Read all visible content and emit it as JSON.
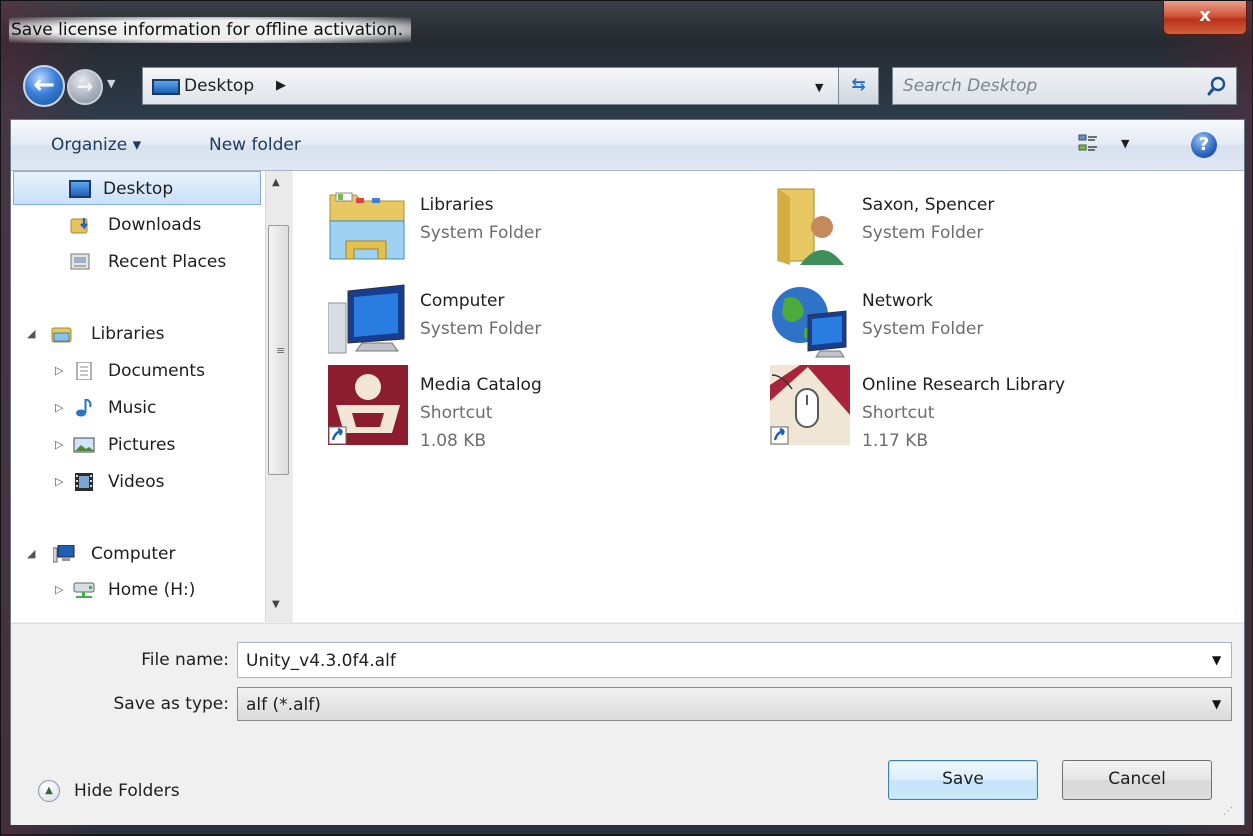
{
  "window": {
    "title": "Save license information for offline activation.",
    "close_label": "x"
  },
  "nav": {
    "back_glyph": "←",
    "forward_glyph": "→",
    "address_location": "Desktop",
    "search_placeholder": "Search Desktop"
  },
  "toolbar": {
    "organize_label": "Organize ▾",
    "new_folder_label": "New folder",
    "help_glyph": "?"
  },
  "sidebar": {
    "items": [
      {
        "label": "Desktop",
        "selected": true
      },
      {
        "label": "Downloads"
      },
      {
        "label": "Recent Places"
      },
      {
        "label": "Libraries"
      },
      {
        "label": "Documents"
      },
      {
        "label": "Music"
      },
      {
        "label": "Pictures"
      },
      {
        "label": "Videos"
      },
      {
        "label": "Computer"
      },
      {
        "label": "Home (H:)"
      }
    ]
  },
  "files": [
    {
      "name": "Libraries",
      "type": "System Folder",
      "icon": "libraries-folder-icon"
    },
    {
      "name": "Saxon, Spencer",
      "type": "System Folder",
      "icon": "user-folder-icon"
    },
    {
      "name": "Computer",
      "type": "System Folder",
      "icon": "computer-icon"
    },
    {
      "name": "Network",
      "type": "System Folder",
      "icon": "network-icon"
    },
    {
      "name": "Media Catalog",
      "type": "Shortcut",
      "size": "1.08 KB",
      "icon": "media-catalog-shortcut-icon"
    },
    {
      "name": "Online Research Library",
      "type": "Shortcut",
      "size": "1.17 KB",
      "icon": "research-library-shortcut-icon"
    }
  ],
  "form": {
    "file_name_label": "File name:",
    "file_name_value": "Unity_v4.3.0f4.alf",
    "save_type_label": "Save as type:",
    "save_type_value": "alf (*.alf)"
  },
  "footer": {
    "hide_folders_label": "Hide Folders",
    "save_label": "Save",
    "cancel_label": "Cancel"
  },
  "colors": {
    "accent": "#3c7fb1",
    "selection": "#c9e0f9"
  }
}
